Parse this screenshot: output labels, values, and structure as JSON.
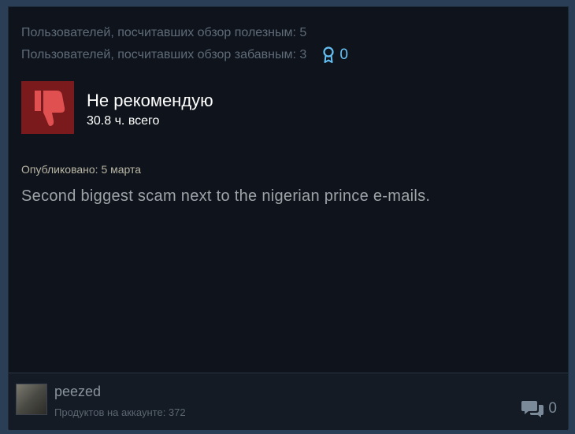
{
  "review": {
    "helpful_text": "Пользователей, посчитавших обзор полезным: 5",
    "funny_text": "Пользователей, посчитавших обзор забавным: 3",
    "awards_count": "0",
    "verdict": "Не рекомендую",
    "hours": "30.8 ч. всего",
    "posted": "Опубликовано: 5 марта",
    "text": "Second biggest scam next to the nigerian prince e-mails."
  },
  "author": {
    "name": "peezed",
    "products": "Продуктов на аккаунте: 372"
  },
  "comments": {
    "count": "0"
  },
  "colors": {
    "card_background": "#0f141c",
    "thumb_background": "#7a1a1c",
    "thumb_icon": "#e05050",
    "award_blue": "#66c0f4"
  }
}
